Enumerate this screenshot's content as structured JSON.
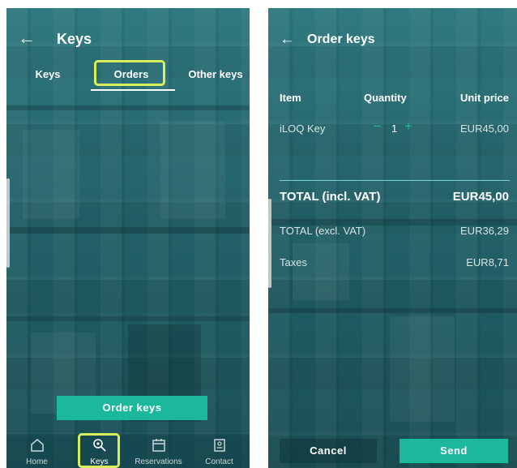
{
  "left_screen": {
    "back_icon": "arrow-left-icon",
    "title": "Keys",
    "tabs": [
      {
        "label": "Keys"
      },
      {
        "label": "Orders"
      },
      {
        "label": "Other keys"
      }
    ],
    "order_button": "Order keys",
    "bottom_nav": [
      {
        "label": "Home",
        "icon": "home-icon"
      },
      {
        "label": "Keys",
        "icon": "key-search-icon"
      },
      {
        "label": "Reservations",
        "icon": "calendar-icon"
      },
      {
        "label": "Contact",
        "icon": "contact-card-icon"
      }
    ]
  },
  "right_screen": {
    "back_icon": "arrow-left-icon",
    "title": "Order keys",
    "table": {
      "headers": {
        "item": "Item",
        "quantity": "Quantity",
        "unit_price": "Unit price"
      },
      "rows": [
        {
          "item": "iLOQ Key",
          "quantity": "1",
          "unit_price": "EUR45,00"
        }
      ]
    },
    "totals": {
      "incl_label": "TOTAL (incl. VAT)",
      "incl_value": "EUR45,00",
      "excl_label": "TOTAL (excl. VAT)",
      "excl_value": "EUR36,29",
      "taxes_label": "Taxes",
      "taxes_value": "EUR8,71"
    },
    "cancel_button": "Cancel",
    "send_button": "Send"
  },
  "colors": {
    "teal_bg": "#25656c",
    "accent_green": "#1bb89c",
    "highlight_yellow": "#d8ee5a"
  }
}
